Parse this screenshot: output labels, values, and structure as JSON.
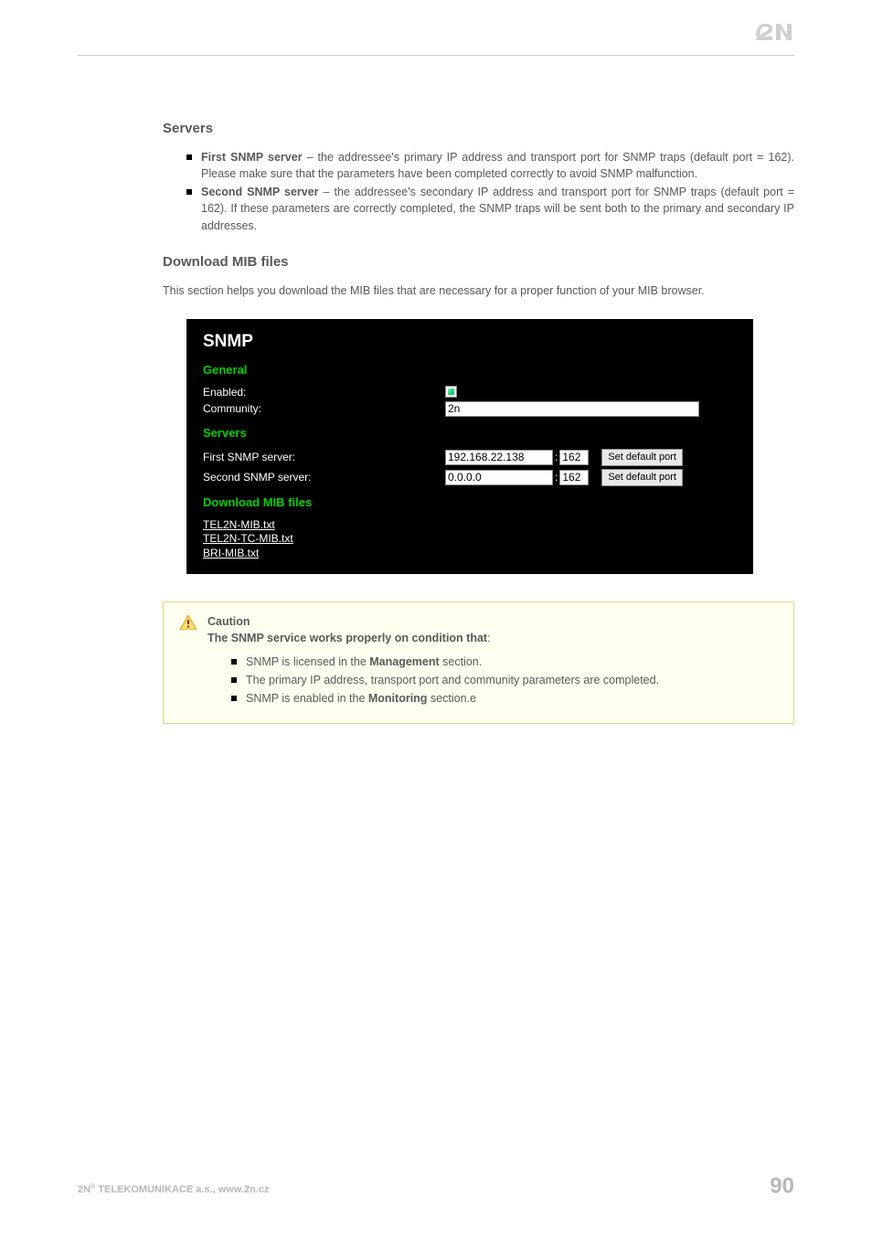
{
  "sections": {
    "servers_heading": "Servers",
    "download_heading": "Download MIB files"
  },
  "bullets": {
    "first_bold": "First SNMP server",
    "first_rest": " – the addressee's primary IP address and transport port for SNMP traps (default port = 162). Please make sure that the parameters have been completed correctly to avoid SNMP malfunction.",
    "second_bold": "Second SNMP server",
    "second_rest": " – the addressee's secondary IP address and transport port for SNMP traps (default port = 162). If these parameters are correctly completed, the SNMP traps will be sent both to the primary and secondary IP addresses."
  },
  "download_para": "This section helps you download the MIB files that are necessary for a proper function of your MIB browser.",
  "shot": {
    "title": "SNMP",
    "grp_general": "General",
    "enabled_label": "Enabled:",
    "community_label": "Community:",
    "community_value": "2n",
    "grp_servers": "Servers",
    "first_label": "First SNMP server:",
    "first_ip": "192.168.22.138",
    "first_port": "162",
    "second_label": "Second SNMP server:",
    "second_ip": "0.0.0.0",
    "second_port": "162",
    "set_default": "Set default port",
    "grp_download": "Download MIB files",
    "mib1": "TEL2N-MIB.txt",
    "mib2": "TEL2N-TC-MIB.txt",
    "mib3": "BRI-MIB.txt"
  },
  "callout": {
    "title": "Caution",
    "subtitle_pre": "The SNMP service works properly on condition that",
    "subtitle_post": ":",
    "b1_pre": "SNMP is licensed in the ",
    "b1_bold": "Management",
    "b1_post": " section.",
    "b2": "The primary IP address, transport port and community parameters are completed.",
    "b3_pre": "SNMP is enabled in the ",
    "b3_bold": "Monitoring",
    "b3_post": " section.e"
  },
  "footer": {
    "company_pre": "2N",
    "company_post": " TELEKOMUNIKACE a.s., www.2n.cz",
    "page": "90"
  }
}
